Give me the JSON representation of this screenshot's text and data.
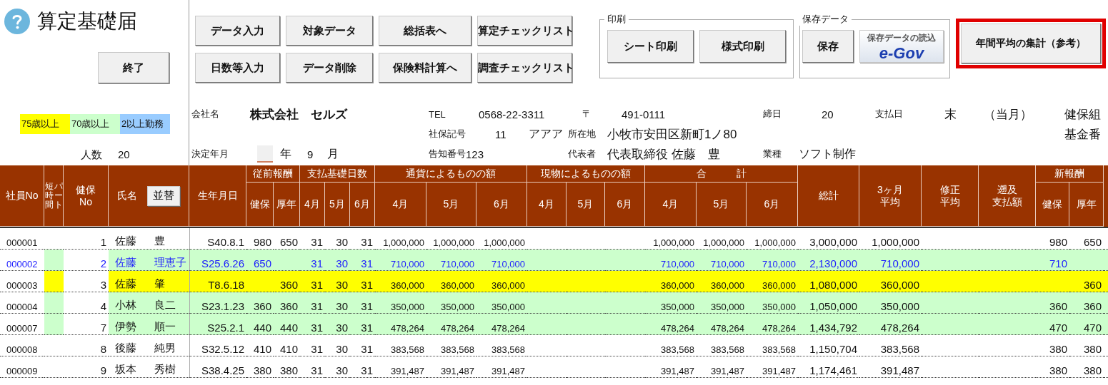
{
  "title": "算定基礎届",
  "exit_button": "終了",
  "legend": [
    {
      "label": "75歳以上",
      "color": "#ffff00"
    },
    {
      "label": "70歳以上",
      "color": "#ccffcc"
    },
    {
      "label": "2以上勤務",
      "color": "#99ccff"
    }
  ],
  "headcount": {
    "label": "人数",
    "value": "20"
  },
  "toolbar_buttons": [
    "データ入力",
    "対象データ",
    "総括表へ",
    "算定チェックリスト",
    "日数等入力",
    "データ削除",
    "保険料計算へ",
    "調査チェックリスト"
  ],
  "print_group": {
    "title": "印刷",
    "buttons": [
      "シート印刷",
      "様式印刷"
    ]
  },
  "save_group": {
    "title": "保存データ",
    "save_button": "保存",
    "egov_button": {
      "caption": "保存データの読込",
      "logo": "e-Gov"
    }
  },
  "annual_average_button": {
    "label": "年間平均の集計（参考）",
    "highlighted": true
  },
  "company_info": {
    "company_name": {
      "label": "会社名",
      "value": "株式会社　セルズ"
    },
    "tel": {
      "label": "TEL",
      "value": "0568-22-3311"
    },
    "postal": {
      "label": "〒",
      "value": "491-0111"
    },
    "closing_day": {
      "label": "締日",
      "value": "20"
    },
    "payday": {
      "label": "支払日",
      "value": "末",
      "note": "（当月）"
    },
    "health_union": "健保組",
    "social_code": {
      "label": "社保記号",
      "value": "11",
      "extra": "アアア"
    },
    "address": {
      "label": "所在地",
      "value": "小牧市安田区新町1ノ80"
    },
    "fund_no": "基金番",
    "decision": {
      "label": "決定年月",
      "year_label": "年",
      "month": "9",
      "month_label": "月"
    },
    "notice_no": {
      "label": "告知番号",
      "value": "123"
    },
    "representative": {
      "label": "代表者",
      "value": "代表取締役 佐藤　豊"
    },
    "industry": {
      "label": "業種",
      "value": "ソフト制作"
    }
  },
  "table": {
    "columns": [
      {
        "kind": "plain",
        "label": "社員No"
      },
      {
        "kind": "vertical",
        "labels": [
          "短時間",
          "パート"
        ]
      },
      {
        "kind": "stacked",
        "lines": [
          "健保",
          "No"
        ]
      },
      {
        "kind": "sortable",
        "label": "氏名",
        "button": "並替"
      },
      {
        "kind": "plain",
        "label": "生年月日"
      },
      {
        "kind": "group",
        "label": "従前報酬",
        "children": [
          "健保",
          "厚年"
        ]
      },
      {
        "kind": "group",
        "label": "支払基礎日数",
        "children": [
          "4月",
          "5月",
          "6月"
        ]
      },
      {
        "kind": "group",
        "label": "通貨によるものの額",
        "children": [
          "4月",
          "5月",
          "6月"
        ]
      },
      {
        "kind": "group",
        "label": "現物によるものの額",
        "children": [
          "4月",
          "5月",
          "6月"
        ]
      },
      {
        "kind": "group",
        "label": "合　　　計",
        "children": [
          "4月",
          "5月",
          "6月"
        ]
      },
      {
        "kind": "plain",
        "label": "総計"
      },
      {
        "kind": "stacked",
        "lines": [
          "3ヶ月",
          "平均"
        ]
      },
      {
        "kind": "stacked",
        "lines": [
          "修正",
          "平均"
        ]
      },
      {
        "kind": "stacked",
        "lines": [
          "遡及",
          "支払額"
        ]
      },
      {
        "kind": "group",
        "label": "新報酬",
        "children": [
          "健保",
          "厚年"
        ]
      }
    ],
    "rows": [
      {
        "employee_no": "000001",
        "health_no": "1",
        "surname": "佐藤",
        "given_name": "豊",
        "birth": "S40.8.1",
        "prev_health": "980",
        "prev_pension": "650",
        "days": [
          "31",
          "30",
          "31"
        ],
        "cash": [
          "1,000,000",
          "1,000,000",
          "1,000,000"
        ],
        "total": [
          "1,000,000",
          "1,000,000",
          "1,000,000"
        ],
        "grand_total": "3,000,000",
        "avg_3m": "1,000,000",
        "new_health": "980",
        "new_pension": "650",
        "modified": false
      },
      {
        "employee_no": "000002",
        "health_no": "2",
        "surname": "佐藤",
        "given_name": "理恵子",
        "birth": "S25.6.26",
        "prev_health": "650",
        "days": [
          "31",
          "30",
          "31"
        ],
        "cash": [
          "710,000",
          "710,000",
          "710,000"
        ],
        "total": [
          "710,000",
          "710,000",
          "710,000"
        ],
        "grand_total": "2,130,000",
        "avg_3m": "710,000",
        "new_health": "710",
        "modified": true,
        "color": "#ccffcc"
      },
      {
        "employee_no": "000003",
        "health_no": "3",
        "surname": "佐藤",
        "given_name": "肇",
        "birth": "T8.6.18",
        "prev_pension": "360",
        "days": [
          "31",
          "30",
          "31"
        ],
        "cash": [
          "360,000",
          "360,000",
          "360,000"
        ],
        "total": [
          "360,000",
          "360,000",
          "360,000"
        ],
        "grand_total": "1,080,000",
        "avg_3m": "360,000",
        "new_pension": "360",
        "modified": false,
        "color": "#ffff00"
      },
      {
        "employee_no": "000004",
        "health_no": "4",
        "surname": "小林",
        "given_name": "良二",
        "birth": "S23.1.23",
        "prev_health": "360",
        "prev_pension": "360",
        "days": [
          "31",
          "30",
          "31"
        ],
        "cash": [
          "350,000",
          "350,000",
          "350,000"
        ],
        "total": [
          "350,000",
          "350,000",
          "350,000"
        ],
        "grand_total": "1,050,000",
        "avg_3m": "350,000",
        "new_health": "360",
        "new_pension": "360",
        "modified": false,
        "color": "#ccffcc"
      },
      {
        "employee_no": "000007",
        "health_no": "7",
        "surname": "伊勢",
        "given_name": "順一",
        "birth": "S25.2.1",
        "prev_health": "440",
        "prev_pension": "440",
        "days": [
          "31",
          "30",
          "31"
        ],
        "cash": [
          "478,264",
          "478,264",
          "478,264"
        ],
        "total": [
          "478,264",
          "478,264",
          "478,264"
        ],
        "grand_total": "1,434,792",
        "avg_3m": "478,264",
        "new_health": "470",
        "new_pension": "470",
        "modified": false,
        "color": "#ccffcc"
      },
      {
        "employee_no": "000008",
        "health_no": "8",
        "surname": "後藤",
        "given_name": "純男",
        "birth": "S32.5.12",
        "prev_health": "410",
        "prev_pension": "410",
        "days": [
          "31",
          "30",
          "31"
        ],
        "cash": [
          "383,568",
          "383,568",
          "383,568"
        ],
        "total": [
          "383,568",
          "383,568",
          "383,568"
        ],
        "grand_total": "1,150,704",
        "avg_3m": "383,568",
        "new_health": "380",
        "new_pension": "380",
        "modified": false
      },
      {
        "employee_no": "000009",
        "health_no": "9",
        "surname": "坂本",
        "given_name": "秀樹",
        "birth": "S38.4.25",
        "prev_health": "380",
        "prev_pension": "380",
        "days": [
          "31",
          "30",
          "31"
        ],
        "cash": [
          "391,487",
          "391,487",
          "391,487"
        ],
        "total": [
          "391,487",
          "391,487",
          "391,487"
        ],
        "grand_total": "1,174,461",
        "avg_3m": "391,487",
        "new_health": "380",
        "new_pension": "380",
        "modified": false
      }
    ]
  }
}
